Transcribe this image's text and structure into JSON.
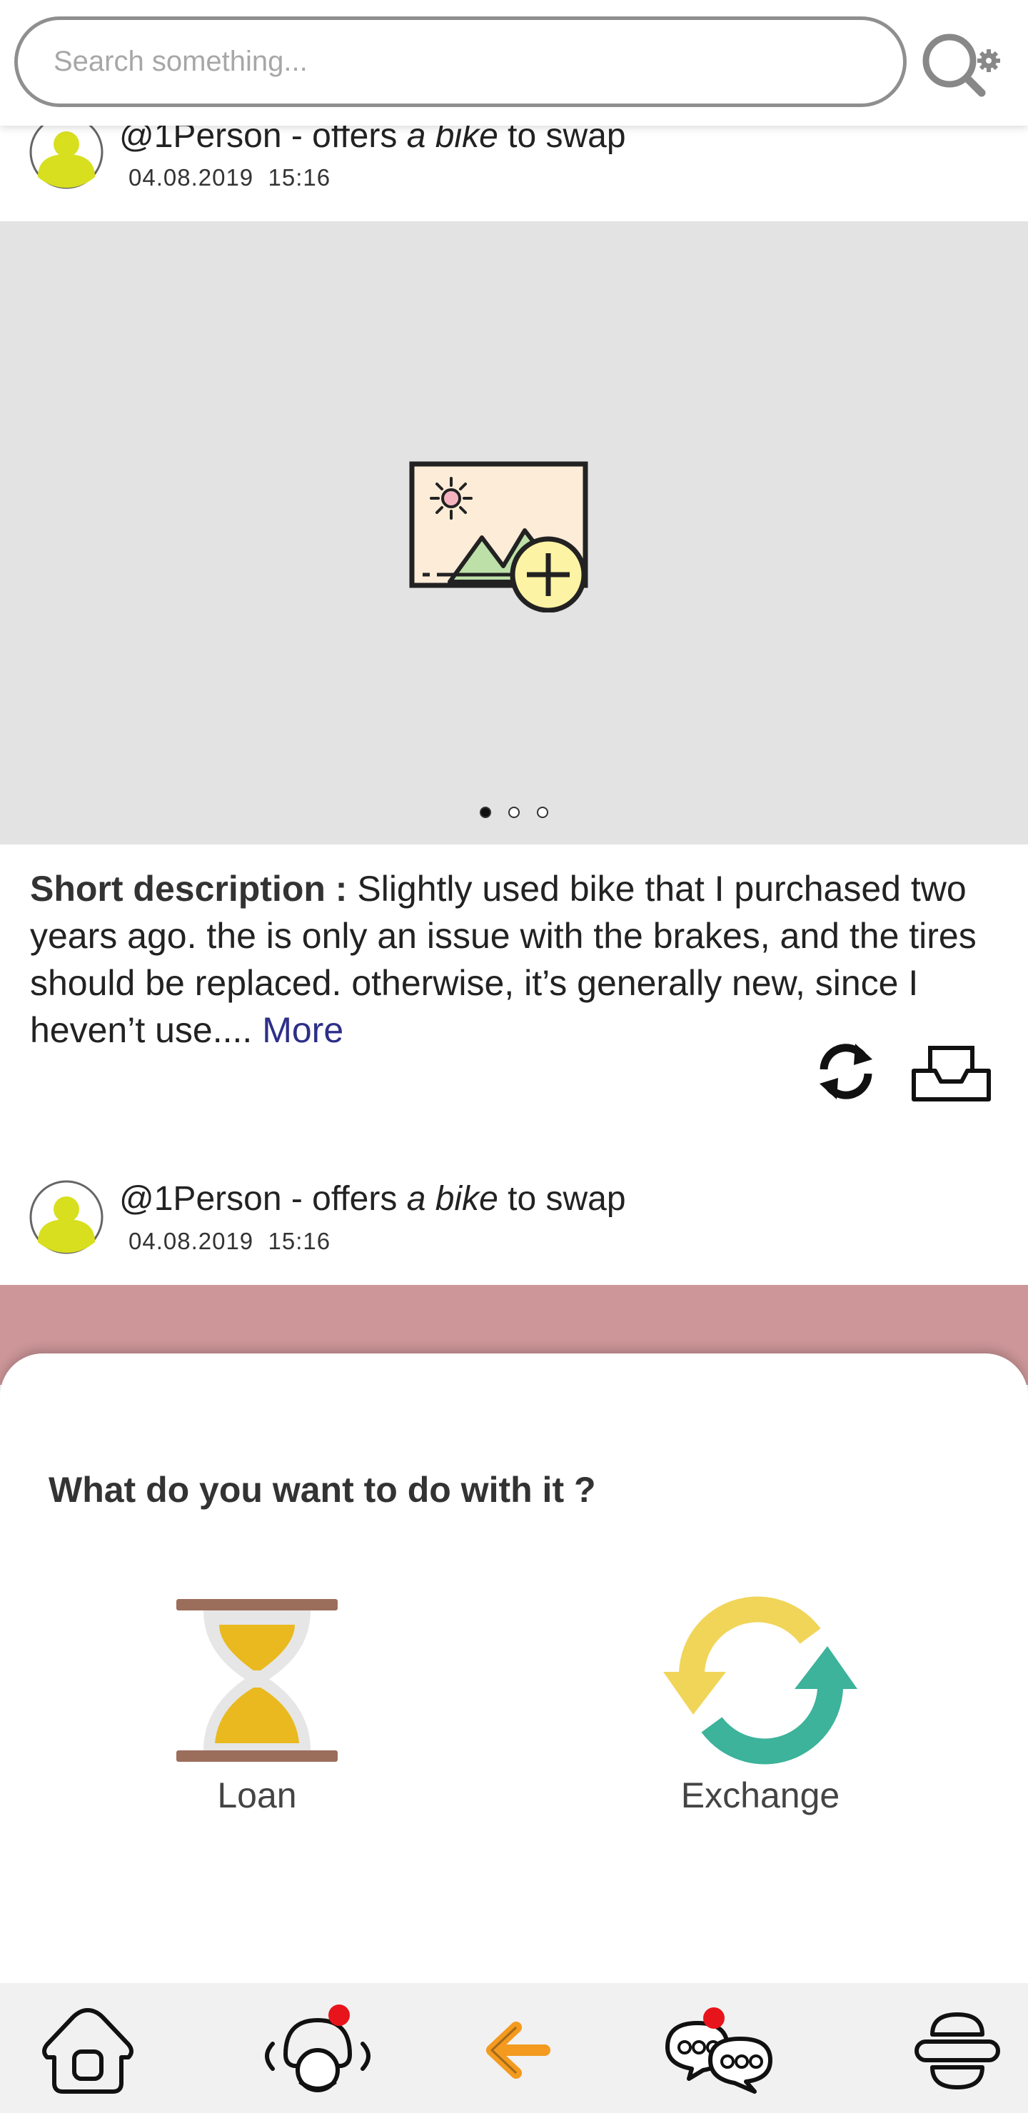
{
  "search": {
    "placeholder": "Search something..."
  },
  "posts": [
    {
      "user": "@1Person",
      "offers_text": " - offers ",
      "item": "a bike",
      "suffix": " to swap",
      "date": "04.08.2019",
      "time": "15:16"
    },
    {
      "user": "@1Person",
      "offers_text": " - offers ",
      "item": "a bike",
      "suffix": " to swap",
      "date": "04.08.2019",
      "time": "15:16"
    }
  ],
  "carousel": {
    "total": 3,
    "active": 1
  },
  "description": {
    "label": "Short description :",
    "text": " Slightly used bike that I purchased two years ago. the is only an issue with the brakes, and the tires should be replaced. otherwise, it’s generally new, since I heven’t use....",
    "more": "More"
  },
  "sheet": {
    "question": "What do you want to do with it ?",
    "options": [
      {
        "label": "Loan",
        "icon": "hourglass-icon"
      },
      {
        "label": "Exchange",
        "icon": "exchange-arrows-icon"
      }
    ]
  },
  "nav": {
    "items": [
      {
        "icon": "home-icon"
      },
      {
        "icon": "community-icon",
        "notification": true
      },
      {
        "icon": "back-arrow-icon"
      },
      {
        "icon": "chat-icon",
        "notification": true
      },
      {
        "icon": "menu-icon"
      }
    ]
  },
  "colors": {
    "avatar": "#d8df1e",
    "accent_orange": "#f39a1f",
    "notification": "#e8141c",
    "more_link": "#2d2f87",
    "pink_band": "#cd9698",
    "hourglass_sand": "#e9b91f",
    "exchange_yellow": "#f1d559",
    "exchange_green": "#3cb39a"
  }
}
